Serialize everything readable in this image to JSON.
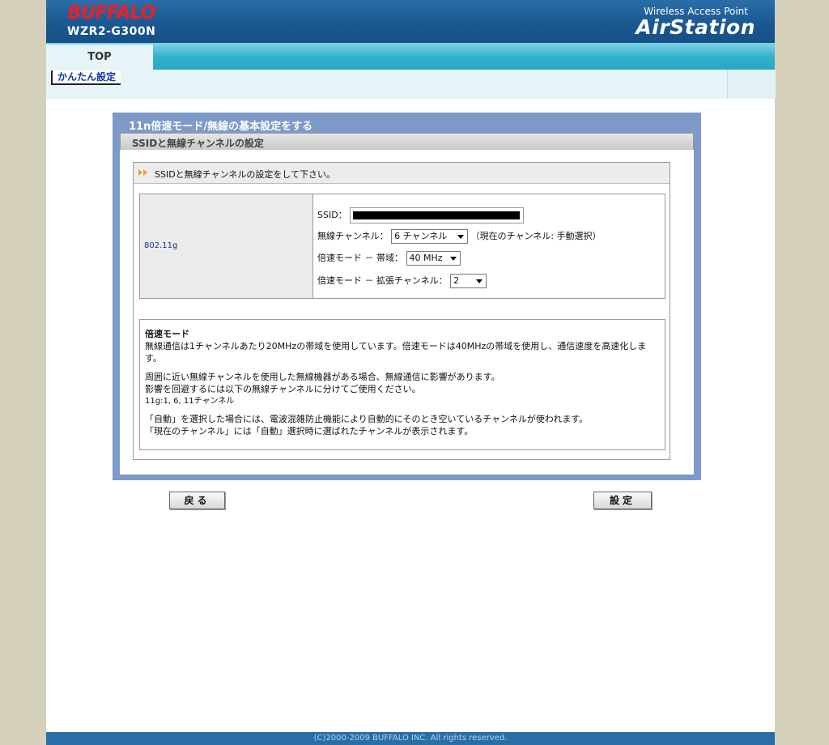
{
  "header": {
    "brand": "BUFFALO",
    "model": "WZR2-G300N",
    "product_tagline": "Wireless Access Point",
    "product_name": "AirStation"
  },
  "nav": {
    "top_tab": "TOP",
    "sub_item": "かんたん設定"
  },
  "panel": {
    "title": "11n倍速モード/無線の基本設定をする",
    "section_title": "SSIDと無線チャンネルの設定",
    "instruction": "SSIDと無線チャンネルの設定をして下さい。",
    "mode_label": "802.11g",
    "ssid_label": "SSID：",
    "ssid_value": "",
    "channel_label": "無線チャンネル：",
    "channel_value": "6 チャンネル",
    "current_channel": "（現在のチャンネル: 手動選択）",
    "bandwidth_label": "倍速モード － 帯域：",
    "bandwidth_value": "40 MHz",
    "ext_channel_label": "倍速モード － 拡張チャンネル：",
    "ext_channel_value": "2"
  },
  "description": {
    "heading": "倍速モード",
    "p1": "無線通信は1チャンネルあたり20MHzの帯域を使用しています。倍速モードは40MHzの帯域を使用し、通信速度を高速化します。",
    "p2_line1": "周囲に近い無線チャンネルを使用した無線機器がある場合、無線通信に影響があります。",
    "p2_line2": "影響を回避するには以下の無線チャンネルに分けてご使用ください。",
    "p2_line3": "11g:1, 6, 11チャンネル",
    "p3_line1": "「自動」を選択した場合には、電波混雑防止機能により自動的にそのとき空いているチャンネルが使われます。",
    "p3_line2": "「現在のチャンネル」には「自動」選択時に選ばれたチャンネルが表示されます。"
  },
  "buttons": {
    "back": "戻る",
    "set": "設定"
  },
  "footer": {
    "copyright": "(C)2000-2009 BUFFALO INC. All rights reserved."
  },
  "colors": {
    "header_blue": "#1a5690",
    "nav_cyan": "#2eb0cc",
    "panel_blue": "#7d9ac8",
    "brand_red": "#e8202a"
  }
}
